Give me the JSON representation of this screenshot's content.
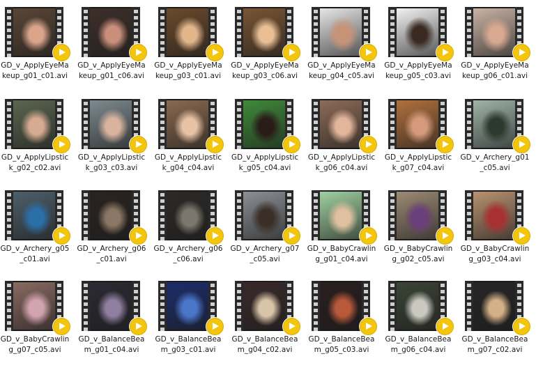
{
  "files": [
    {
      "name": "GD_v_ApplyEyeMakeup_g01_c01.avi",
      "bg": "#5a4636",
      "fg": "#d9a48a"
    },
    {
      "name": "GD_v_ApplyEyeMakeup_g01_c06.avi",
      "bg": "#3d2f2a",
      "fg": "#c98f7a"
    },
    {
      "name": "GD_v_ApplyEyeMakeup_g03_c01.avi",
      "bg": "#6b4a2c",
      "fg": "#e2b58b"
    },
    {
      "name": "GD_v_ApplyEyeMakeup_g03_c06.avi",
      "bg": "#7a5533",
      "fg": "#e8bf95"
    },
    {
      "name": "GD_v_ApplyEyeMakeup_g04_c05.avi",
      "bg": "#e6e6e6",
      "fg": "#c79378"
    },
    {
      "name": "GD_v_ApplyEyeMakeup_g05_c03.avi",
      "bg": "#f2f2f2",
      "fg": "#3a2a22"
    },
    {
      "name": "GD_v_ApplyEyeMakeup_g06_c01.avi",
      "bg": "#c9b3a5",
      "fg": "#d8a890"
    },
    {
      "name": "GD_v_ApplyLipstick_g02_c02.avi",
      "bg": "#5b6650",
      "fg": "#d7ab92"
    },
    {
      "name": "GD_v_ApplyLipstick_g03_c03.avi",
      "bg": "#7d8a8f",
      "fg": "#d9b39d"
    },
    {
      "name": "GD_v_ApplyLipstick_g04_c04.avi",
      "bg": "#8a6a50",
      "fg": "#e6c2a6"
    },
    {
      "name": "GD_v_ApplyLipstick_g05_c04.avi",
      "bg": "#3f8a3a",
      "fg": "#2a1c17"
    },
    {
      "name": "GD_v_ApplyLipstick_g06_c04.avi",
      "bg": "#8d6b58",
      "fg": "#e3b69c"
    },
    {
      "name": "GD_v_ApplyLipstick_g07_c04.avi",
      "bg": "#b0713c",
      "fg": "#d59a7c"
    },
    {
      "name": "GD_v_Archery_g01_c05.avi",
      "bg": "#9fb4a8",
      "fg": "#2c3a2e"
    },
    {
      "name": "GD_v_Archery_g05_c01.avi",
      "bg": "#4e5f6a",
      "fg": "#2b6fa8"
    },
    {
      "name": "GD_v_Archery_g06_c01.avi",
      "bg": "#2a2420",
      "fg": "#8b7765"
    },
    {
      "name": "GD_v_Archery_g06_c06.avi",
      "bg": "#2c2a27",
      "fg": "#7c776e"
    },
    {
      "name": "GD_v_Archery_g07_c05.avi",
      "bg": "#8b9095",
      "fg": "#3b2e26"
    },
    {
      "name": "GD_v_BabyCrawling_g01_c04.avi",
      "bg": "#9fd0a0",
      "fg": "#e0c0a0"
    },
    {
      "name": "GD_v_BabyCrawling_g02_c05.avi",
      "bg": "#9c8a74",
      "fg": "#6a3f7a"
    },
    {
      "name": "GD_v_BabyCrawling_g03_c04.avi",
      "bg": "#b89270",
      "fg": "#a83030"
    },
    {
      "name": "GD_v_BabyCrawling_g07_c05.avi",
      "bg": "#8a6a62",
      "fg": "#d2a3b0"
    },
    {
      "name": "GD_v_BalanceBeam_g01_c04.avi",
      "bg": "#2c2a33",
      "fg": "#8f7fa0"
    },
    {
      "name": "GD_v_BalanceBeam_g03_c01.avi",
      "bg": "#1c2d6b",
      "fg": "#4a76c8"
    },
    {
      "name": "GD_v_BalanceBeam_g04_c02.avi",
      "bg": "#3a2a2a",
      "fg": "#d8c5a8"
    },
    {
      "name": "GD_v_BalanceBeam_g05_c03.avi",
      "bg": "#2a1e1e",
      "fg": "#b85a3a"
    },
    {
      "name": "GD_v_BalanceBeam_g06_c04.avi",
      "bg": "#3b4436",
      "fg": "#c9c9c0"
    },
    {
      "name": "GD_v_BalanceBeam_g07_c02.avi",
      "bg": "#262626",
      "fg": "#d4b088"
    }
  ]
}
